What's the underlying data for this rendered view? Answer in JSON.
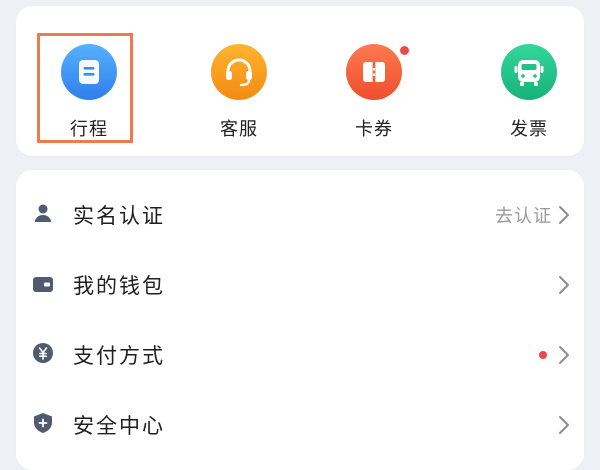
{
  "quick_actions": [
    {
      "label": "行程",
      "icon": "trip-list-icon",
      "color": "#3a8df0"
    },
    {
      "label": "客服",
      "icon": "headset-icon",
      "color": "#f79a1d"
    },
    {
      "label": "卡券",
      "icon": "coupon-icon",
      "color": "#f2613e",
      "has_badge": true
    },
    {
      "label": "发票",
      "icon": "invoice-bus-icon",
      "color": "#23c08a"
    }
  ],
  "menu": [
    {
      "label": "实名认证",
      "hint": "去认证",
      "icon": "person-icon"
    },
    {
      "label": "我的钱包",
      "hint": "",
      "icon": "wallet-icon"
    },
    {
      "label": "支付方式",
      "hint": "",
      "icon": "yuan-icon",
      "has_badge": true
    },
    {
      "label": "安全中心",
      "hint": "",
      "icon": "shield-icon"
    }
  ],
  "colors": {
    "icon_gray": "#515a6e",
    "badge_red": "#ef4a4a",
    "highlight": "#f07a4f"
  }
}
